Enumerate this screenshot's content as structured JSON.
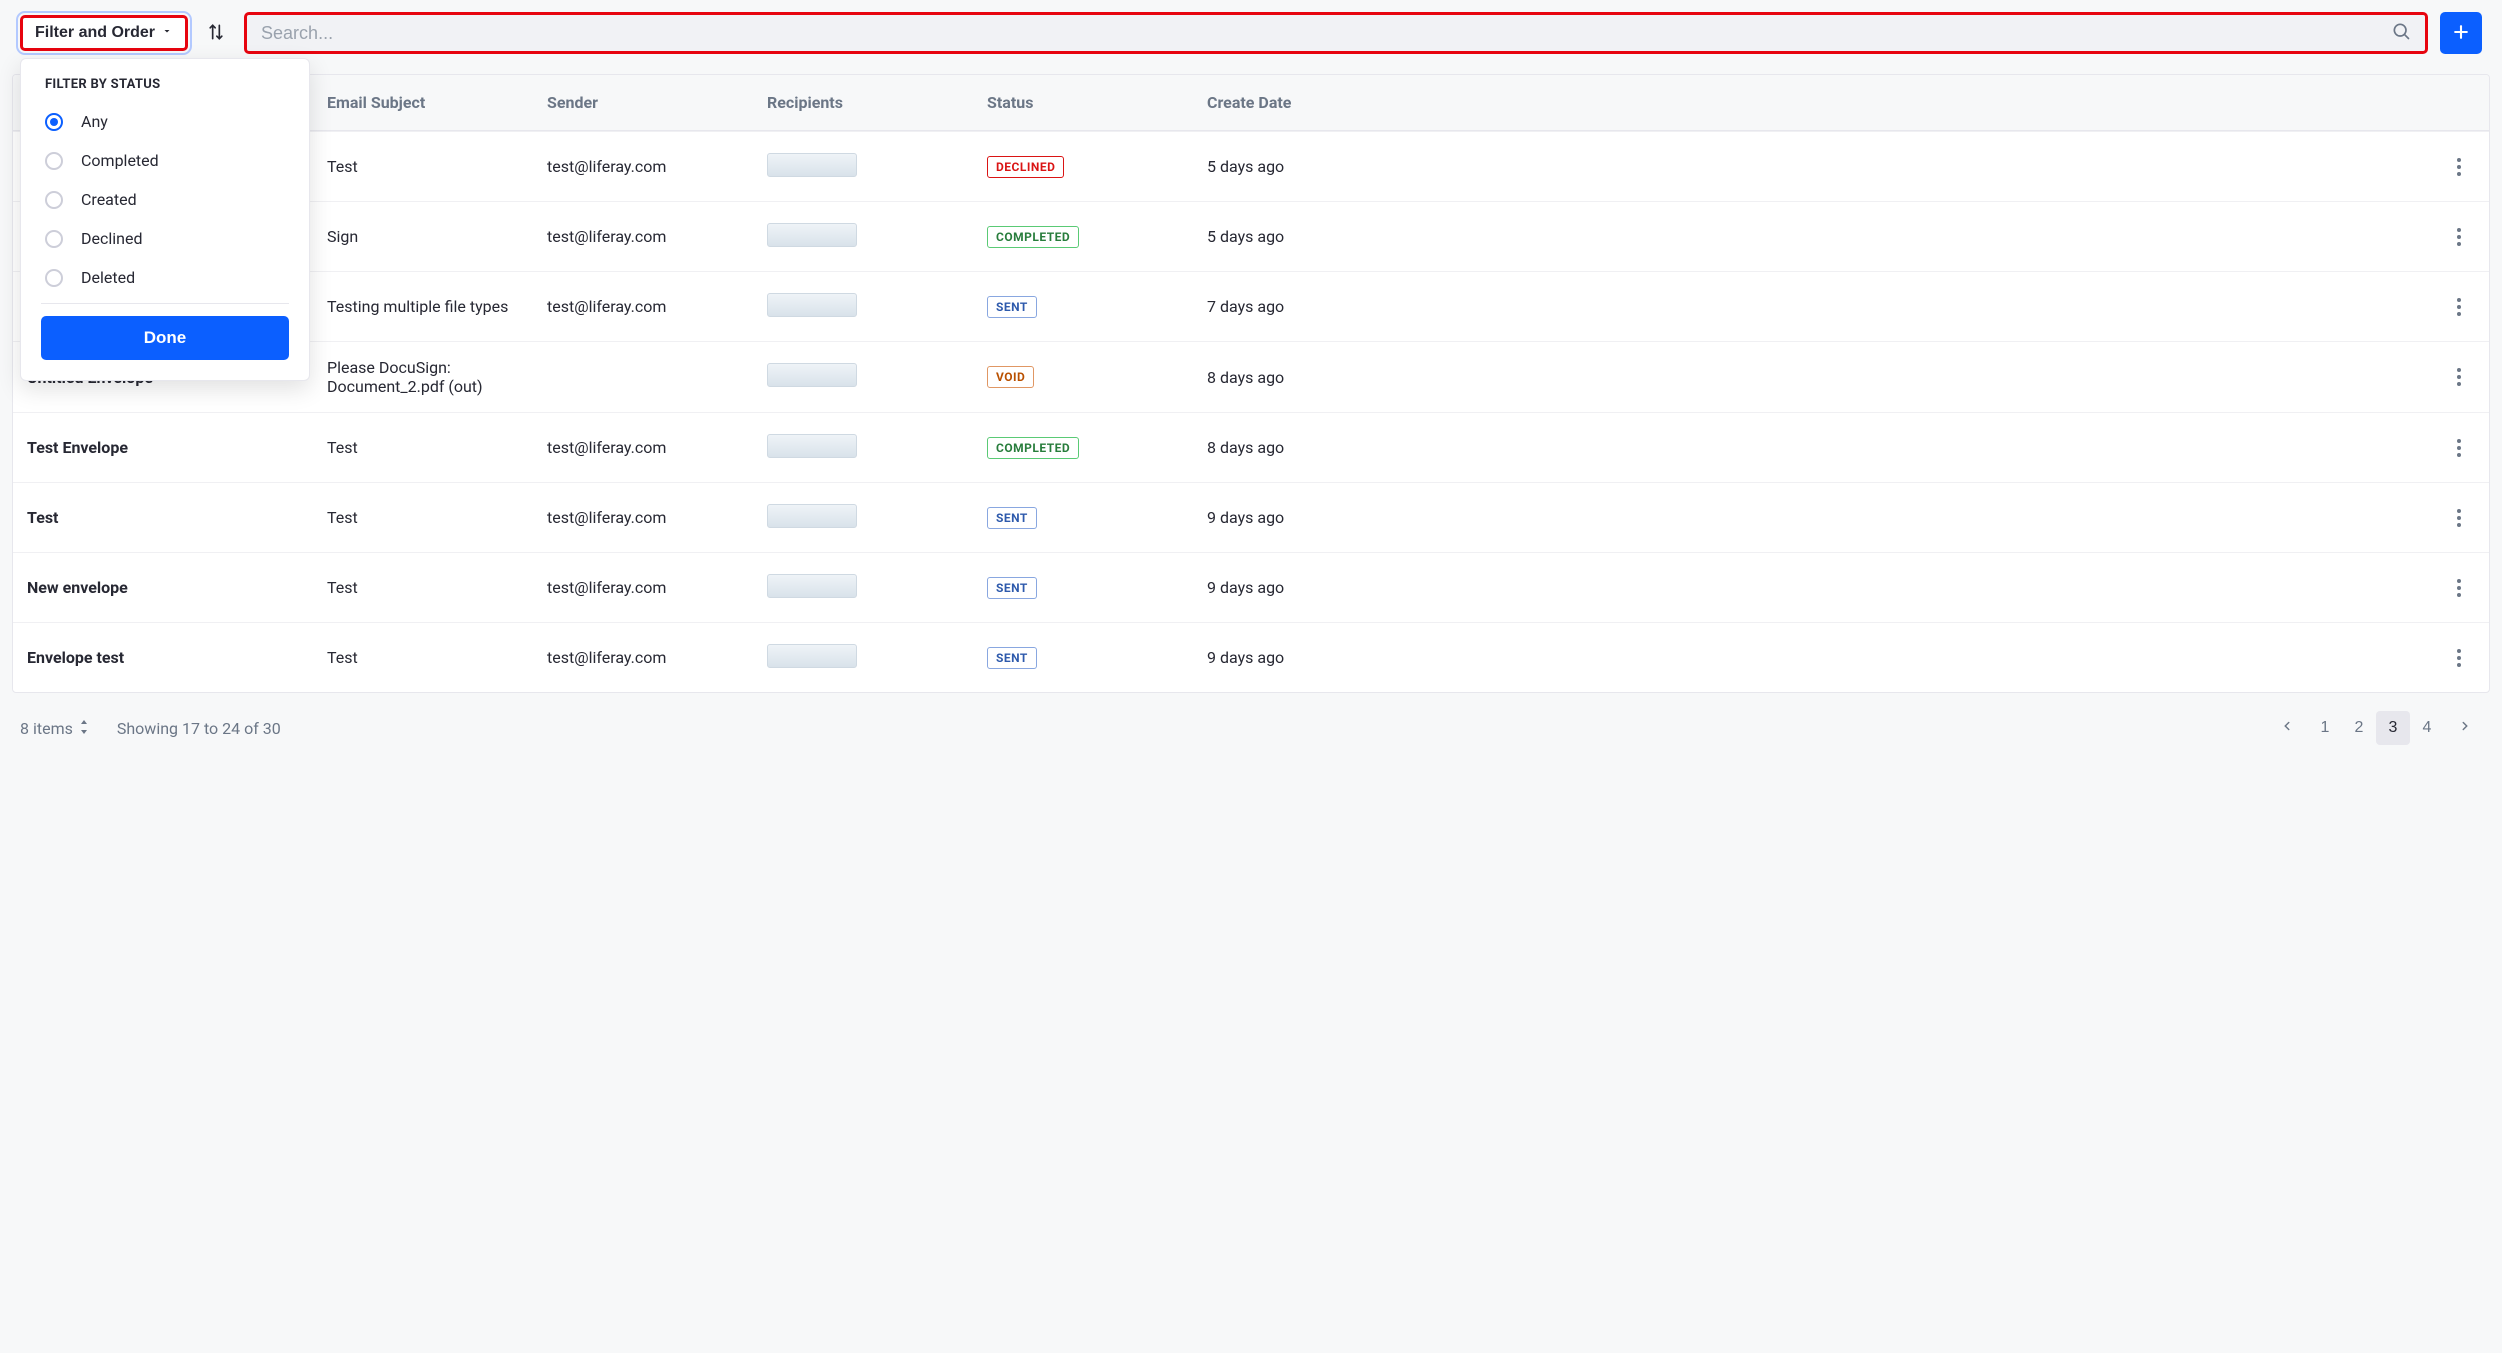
{
  "toolbar": {
    "filter_order_label": "Filter and Order",
    "search_placeholder": "Search..."
  },
  "filter_dropdown": {
    "header": "FILTER BY STATUS",
    "options": [
      {
        "label": "Any",
        "checked": true
      },
      {
        "label": "Completed",
        "checked": false
      },
      {
        "label": "Created",
        "checked": false
      },
      {
        "label": "Declined",
        "checked": false
      },
      {
        "label": "Deleted",
        "checked": false
      }
    ],
    "done_label": "Done"
  },
  "table": {
    "columns": [
      "",
      "Email Subject",
      "Sender",
      "Recipients",
      "Status",
      "Create Date"
    ],
    "rows": [
      {
        "name": "",
        "subject": "Test",
        "sender": "test@liferay.com",
        "status": "DECLINED",
        "status_class": "declined",
        "created": "5 days ago"
      },
      {
        "name": "",
        "subject": "Sign",
        "sender": "test@liferay.com",
        "status": "COMPLETED",
        "status_class": "completed",
        "created": "5 days ago"
      },
      {
        "name": "",
        "subject": "Testing multiple file types",
        "sender": "test@liferay.com",
        "status": "SENT",
        "status_class": "sent",
        "created": "7 days ago"
      },
      {
        "name": "Untitled Envelope",
        "subject": "Please DocuSign: Document_2.pdf (out)",
        "sender": "",
        "status": "VOID",
        "status_class": "void",
        "created": "8 days ago"
      },
      {
        "name": "Test Envelope",
        "subject": "Test",
        "sender": "test@liferay.com",
        "status": "COMPLETED",
        "status_class": "completed",
        "created": "8 days ago"
      },
      {
        "name": "Test",
        "subject": "Test",
        "sender": "test@liferay.com",
        "status": "SENT",
        "status_class": "sent",
        "created": "9 days ago"
      },
      {
        "name": "New envelope",
        "subject": "Test",
        "sender": "test@liferay.com",
        "status": "SENT",
        "status_class": "sent",
        "created": "9 days ago"
      },
      {
        "name": "Envelope test",
        "subject": "Test",
        "sender": "test@liferay.com",
        "status": "SENT",
        "status_class": "sent",
        "created": "9 days ago"
      }
    ]
  },
  "footer": {
    "items_label": "8 items",
    "showing_label": "Showing 17 to 24 of 30",
    "pages": [
      "1",
      "2",
      "3",
      "4"
    ],
    "current_page": "3"
  }
}
